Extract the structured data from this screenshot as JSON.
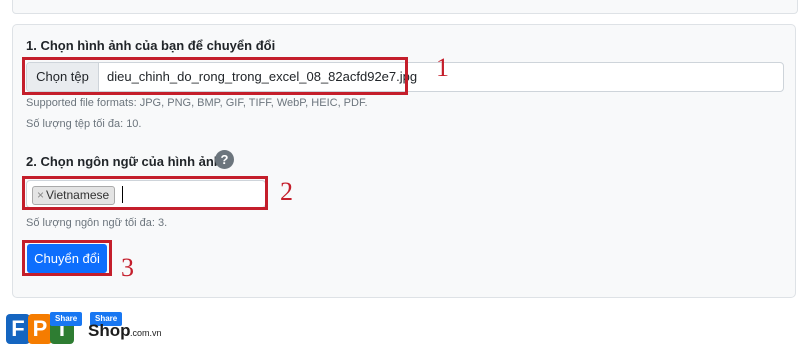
{
  "step1": {
    "label": "1. Chọn hình ảnh của bạn để chuyển đổi",
    "choose_button": "Chọn tệp",
    "file_name": "dieu_chinh_do_rong_trong_excel_08_82acfd92e7.jpg",
    "formats_hint": "Supported file formats: JPG, PNG, BMP, GIF, TIFF, WebP, HEIC, PDF.",
    "max_files_hint": "Số lượng tệp tối đa: 10."
  },
  "step2": {
    "label": "2. Chọn ngôn ngữ của hình ảnh",
    "help_icon": "question-circle-icon",
    "help_glyph": "?",
    "selected_language": "Vietnamese",
    "remove_glyph": "×",
    "max_languages_hint": "Số lượng ngôn ngữ tối đa: 3."
  },
  "convert_button": "Chuyển đổi",
  "annotations": {
    "color": "#c41e2b",
    "numbers": [
      "1",
      "2",
      "3"
    ]
  },
  "logo": {
    "letters": [
      "F",
      "P",
      "T"
    ],
    "letter_colors": [
      "#1565c0",
      "#f57c00",
      "#2e7d32"
    ],
    "share_labels": [
      "Share",
      "Share"
    ],
    "shop_text": "Shop",
    "domain_text": ".com.vn"
  }
}
